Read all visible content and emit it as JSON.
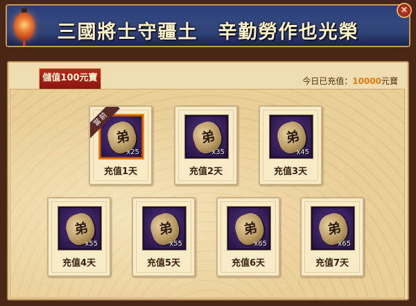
{
  "banner": {
    "title": "三國將士守疆土　辛勤勞作也光榮",
    "close_label": "×"
  },
  "tab": {
    "label": "儲值100元寶"
  },
  "status": {
    "prefix": "今日已充值：",
    "amount": "10000",
    "unit": "元寶"
  },
  "ribbon": {
    "label": "當前"
  },
  "rewards": [
    {
      "glyph": "弟",
      "qty": "x25",
      "day": "充值1天"
    },
    {
      "glyph": "弟",
      "qty": "x35",
      "day": "充值2天"
    },
    {
      "glyph": "弟",
      "qty": "x45",
      "day": "充值3天"
    },
    {
      "glyph": "弟",
      "qty": "x55",
      "day": "充值4天"
    },
    {
      "glyph": "弟",
      "qty": "x55",
      "day": "充值5天"
    },
    {
      "glyph": "弟",
      "qty": "x65",
      "day": "充值6天"
    },
    {
      "glyph": "弟",
      "qty": "x65",
      "day": "充值7天"
    }
  ]
}
